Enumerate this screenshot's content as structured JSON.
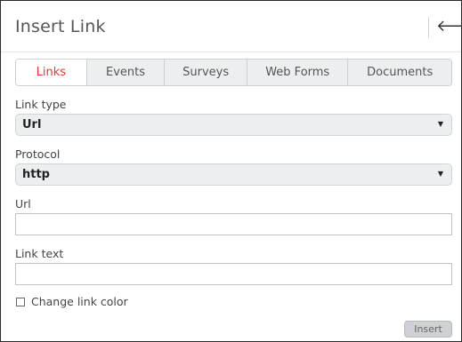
{
  "dialog": {
    "title": "Insert Link",
    "back_icon": "arrow-left-icon",
    "back_glyph": "🡐"
  },
  "tabs": [
    {
      "label": "Links",
      "active": true
    },
    {
      "label": "Events",
      "active": false
    },
    {
      "label": "Surveys",
      "active": false
    },
    {
      "label": "Web Forms",
      "active": false
    },
    {
      "label": "Documents",
      "active": false
    }
  ],
  "form": {
    "link_type_label": "Link type",
    "link_type_value": "Url",
    "protocol_label": "Protocol",
    "protocol_value": "http",
    "url_label": "Url",
    "url_value": "",
    "link_text_label": "Link text",
    "link_text_value": "",
    "change_color_label": "Change link color",
    "change_color_checked": false,
    "caret_glyph": "▼",
    "caret_icon": "caret-down-icon"
  },
  "actions": {
    "insert_label": "Insert"
  },
  "colors": {
    "active_tab_text": "#e03a2f",
    "tab_background": "#eceef0",
    "select_background": "#edeef0",
    "insert_button_background": "#cfd1d4"
  }
}
